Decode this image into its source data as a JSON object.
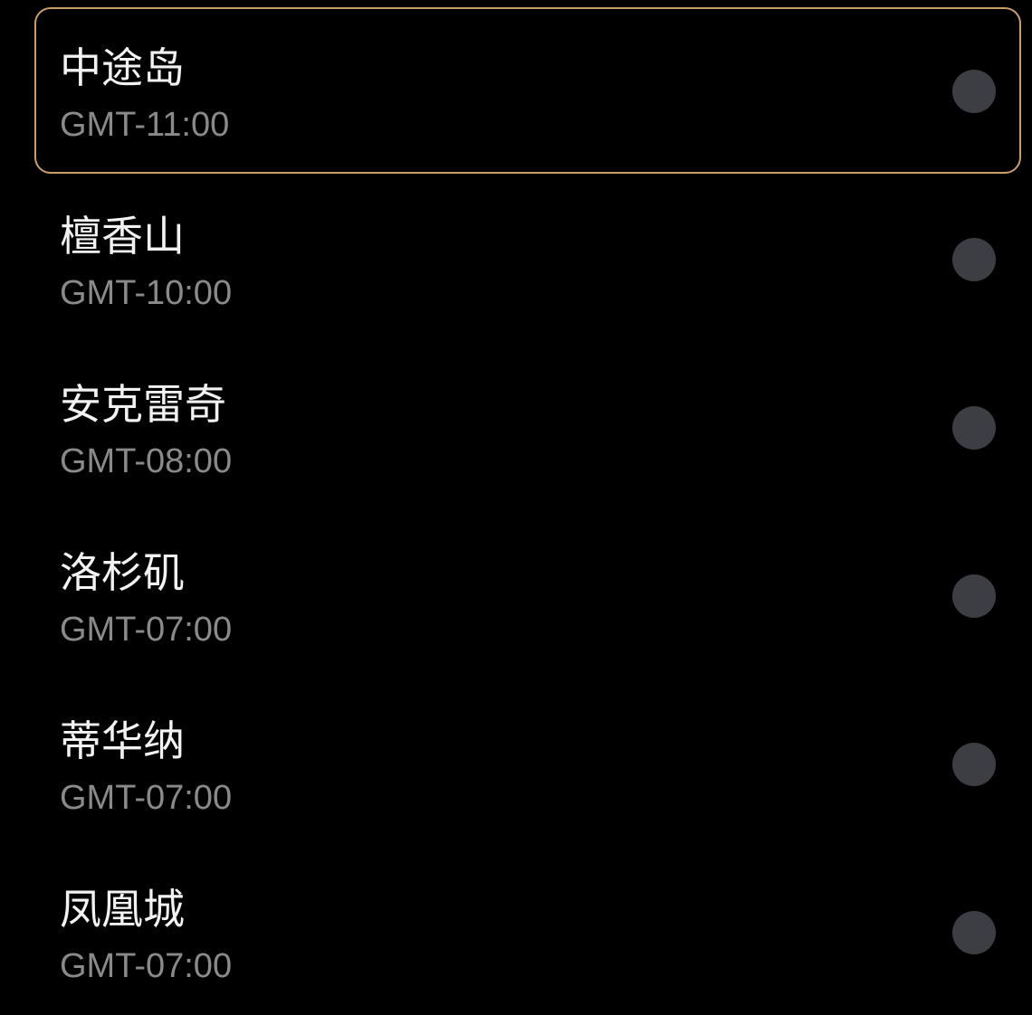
{
  "timezone_list": {
    "items": [
      {
        "name": "中途岛",
        "offset": "GMT-11:00",
        "focused": true
      },
      {
        "name": "檀香山",
        "offset": "GMT-10:00",
        "focused": false
      },
      {
        "name": "安克雷奇",
        "offset": "GMT-08:00",
        "focused": false
      },
      {
        "name": "洛杉矶",
        "offset": "GMT-07:00",
        "focused": false
      },
      {
        "name": "蒂华纳",
        "offset": "GMT-07:00",
        "focused": false
      },
      {
        "name": "凤凰城",
        "offset": "GMT-07:00",
        "focused": false
      }
    ]
  },
  "colors": {
    "background": "#000000",
    "focus_border": "#c9a06a",
    "radio_unselected": "#3d3e43",
    "primary_text": "#f2f2f2",
    "secondary_text": "#8a8a8a"
  }
}
